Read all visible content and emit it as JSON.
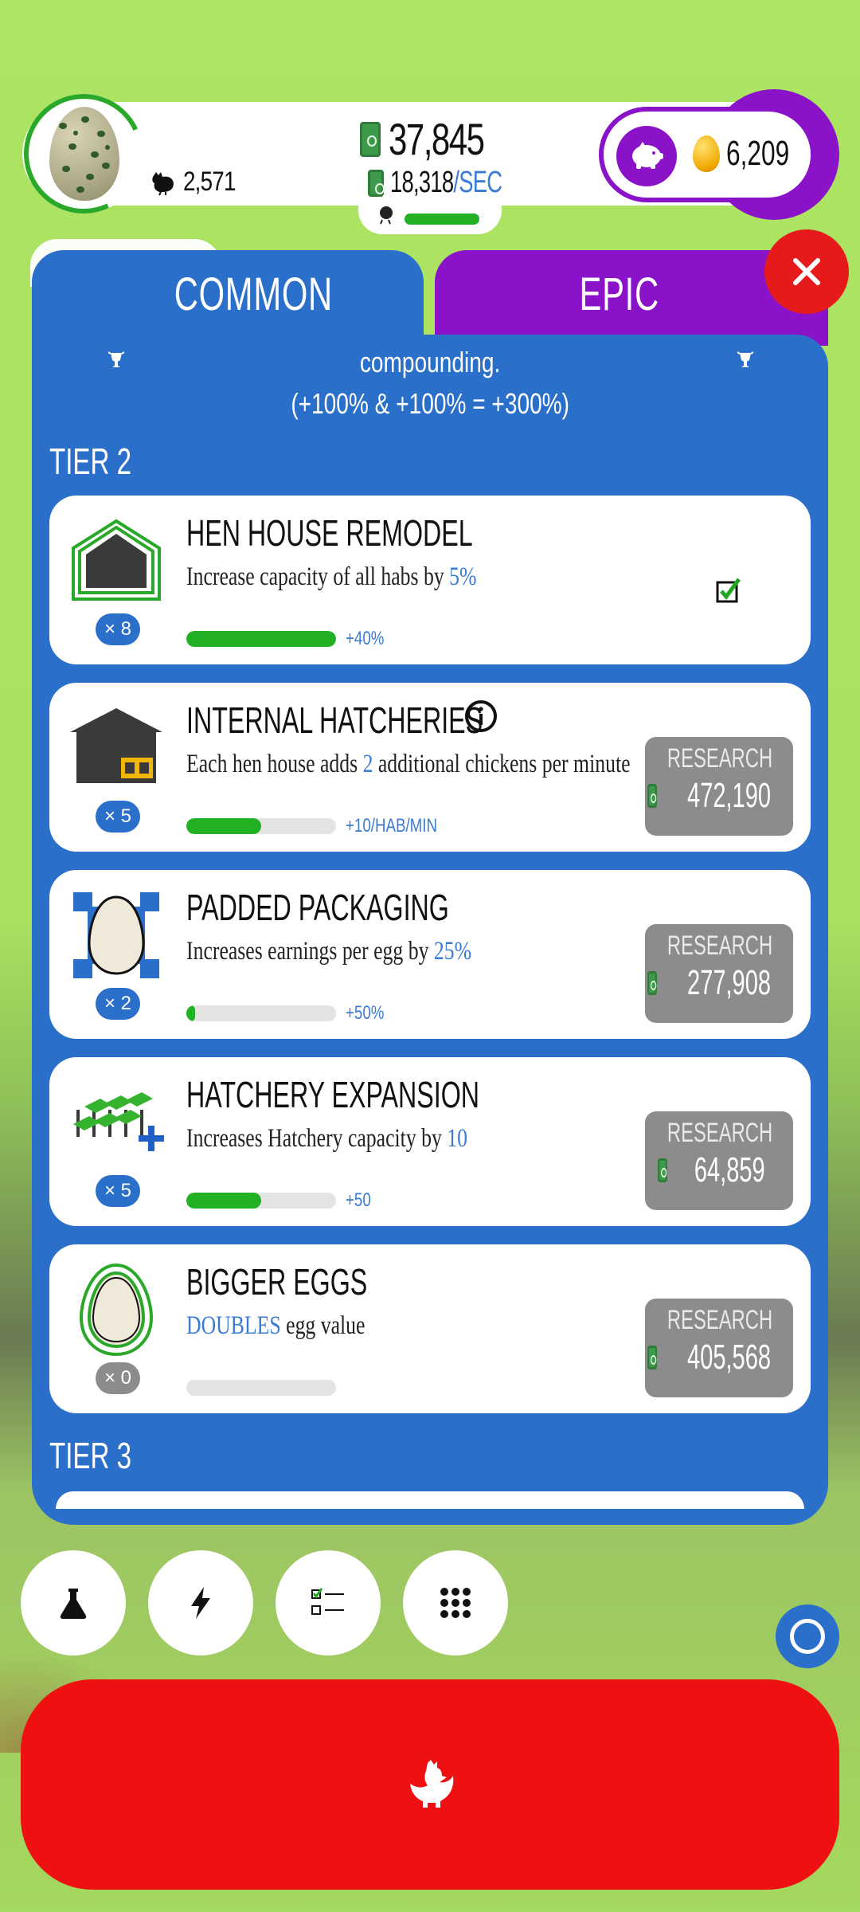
{
  "header": {
    "chicken_count": "2,571",
    "money": "37,845",
    "rate_value": "18,318",
    "rate_unit": "/SEC",
    "golden_eggs": "6,209"
  },
  "tabs": [
    {
      "label": "COMMON"
    },
    {
      "label": "EPIC"
    }
  ],
  "panel": {
    "description_line1": "compounding.",
    "description_line2": "(+100% & +100% = +300%)"
  },
  "tiers": [
    {
      "label": "TIER 2"
    },
    {
      "label": "TIER 3"
    }
  ],
  "upgrades": [
    {
      "title": "HEN HOUSE REMODEL",
      "desc_prefix": "Increase capacity of all habs by ",
      "desc_value": "5%",
      "desc_suffix": "",
      "level": "× 8",
      "progress": 1.0,
      "bonus": "+40%",
      "completed": true,
      "icon": "hen-house-icon"
    },
    {
      "title": "INTERNAL HATCHERIES",
      "desc_prefix": "Each hen house adds ",
      "desc_value": "2",
      "desc_suffix": " additional chickens per minute",
      "level": "× 5",
      "progress": 0.5,
      "bonus": "+10/HAB/MIN",
      "research_label": "RESEARCH",
      "cost": "472,190",
      "icon": "hatchery-house-icon"
    },
    {
      "title": "PADDED PACKAGING",
      "desc_prefix": "Increases earnings per egg by ",
      "desc_value": "25%",
      "desc_suffix": "",
      "level": "× 2",
      "progress": 0.06,
      "bonus": "+50%",
      "research_label": "RESEARCH",
      "cost": "277,908",
      "icon": "padded-egg-icon"
    },
    {
      "title": "HATCHERY EXPANSION",
      "desc_prefix": "Increases Hatchery capacity by ",
      "desc_value": "10",
      "desc_suffix": "",
      "level": "× 5",
      "progress": 0.5,
      "bonus": "+50",
      "research_label": "RESEARCH",
      "cost": "64,859",
      "icon": "hatchery-expansion-icon"
    },
    {
      "title": "BIGGER EGGS",
      "desc_prefix": "",
      "desc_value": "DOUBLES",
      "desc_suffix": " egg value",
      "level": "× 0",
      "progress": 0.0,
      "bonus": "",
      "research_label": "RESEARCH",
      "cost": "405,568",
      "icon": "bigger-egg-icon"
    }
  ],
  "colors": {
    "panel_blue": "#2a6fc9",
    "epic_purple": "#8a12c8",
    "progress_green": "#22b024",
    "highlight_blue": "#3a7bd5",
    "hatch_red": "#ef1111",
    "background_green": "#ade463"
  },
  "bottom_buttons": [
    "research-flask-icon",
    "boost-lightning-icon",
    "missions-checklist-icon",
    "menu-grid-icon"
  ]
}
